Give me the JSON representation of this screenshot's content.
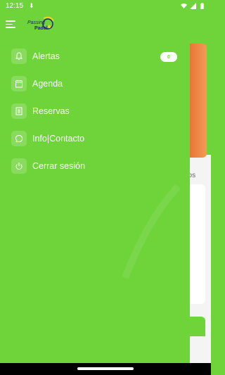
{
  "status_bar": {
    "time": "12:15",
    "download_icon": "download-icon"
  },
  "header": {
    "menu_icon": "hamburger-icon",
    "logo_line1": "Passing",
    "logo_line2": "Padel"
  },
  "drawer": {
    "items": [
      {
        "label": "Alertas",
        "icon": "bell-icon",
        "toggle_count": "0"
      },
      {
        "label": "Agenda",
        "icon": "calendar-icon"
      },
      {
        "label": "Reservas",
        "icon": "ticket-icon"
      },
      {
        "label": "Info|Contacto",
        "icon": "chat-icon"
      },
      {
        "label": "Cerrar sesión",
        "icon": "power-icon"
      }
    ]
  },
  "background": {
    "partial_text": "dos"
  },
  "colors": {
    "primary": "#6fd33a",
    "accent_orange": "#e86a2a"
  }
}
